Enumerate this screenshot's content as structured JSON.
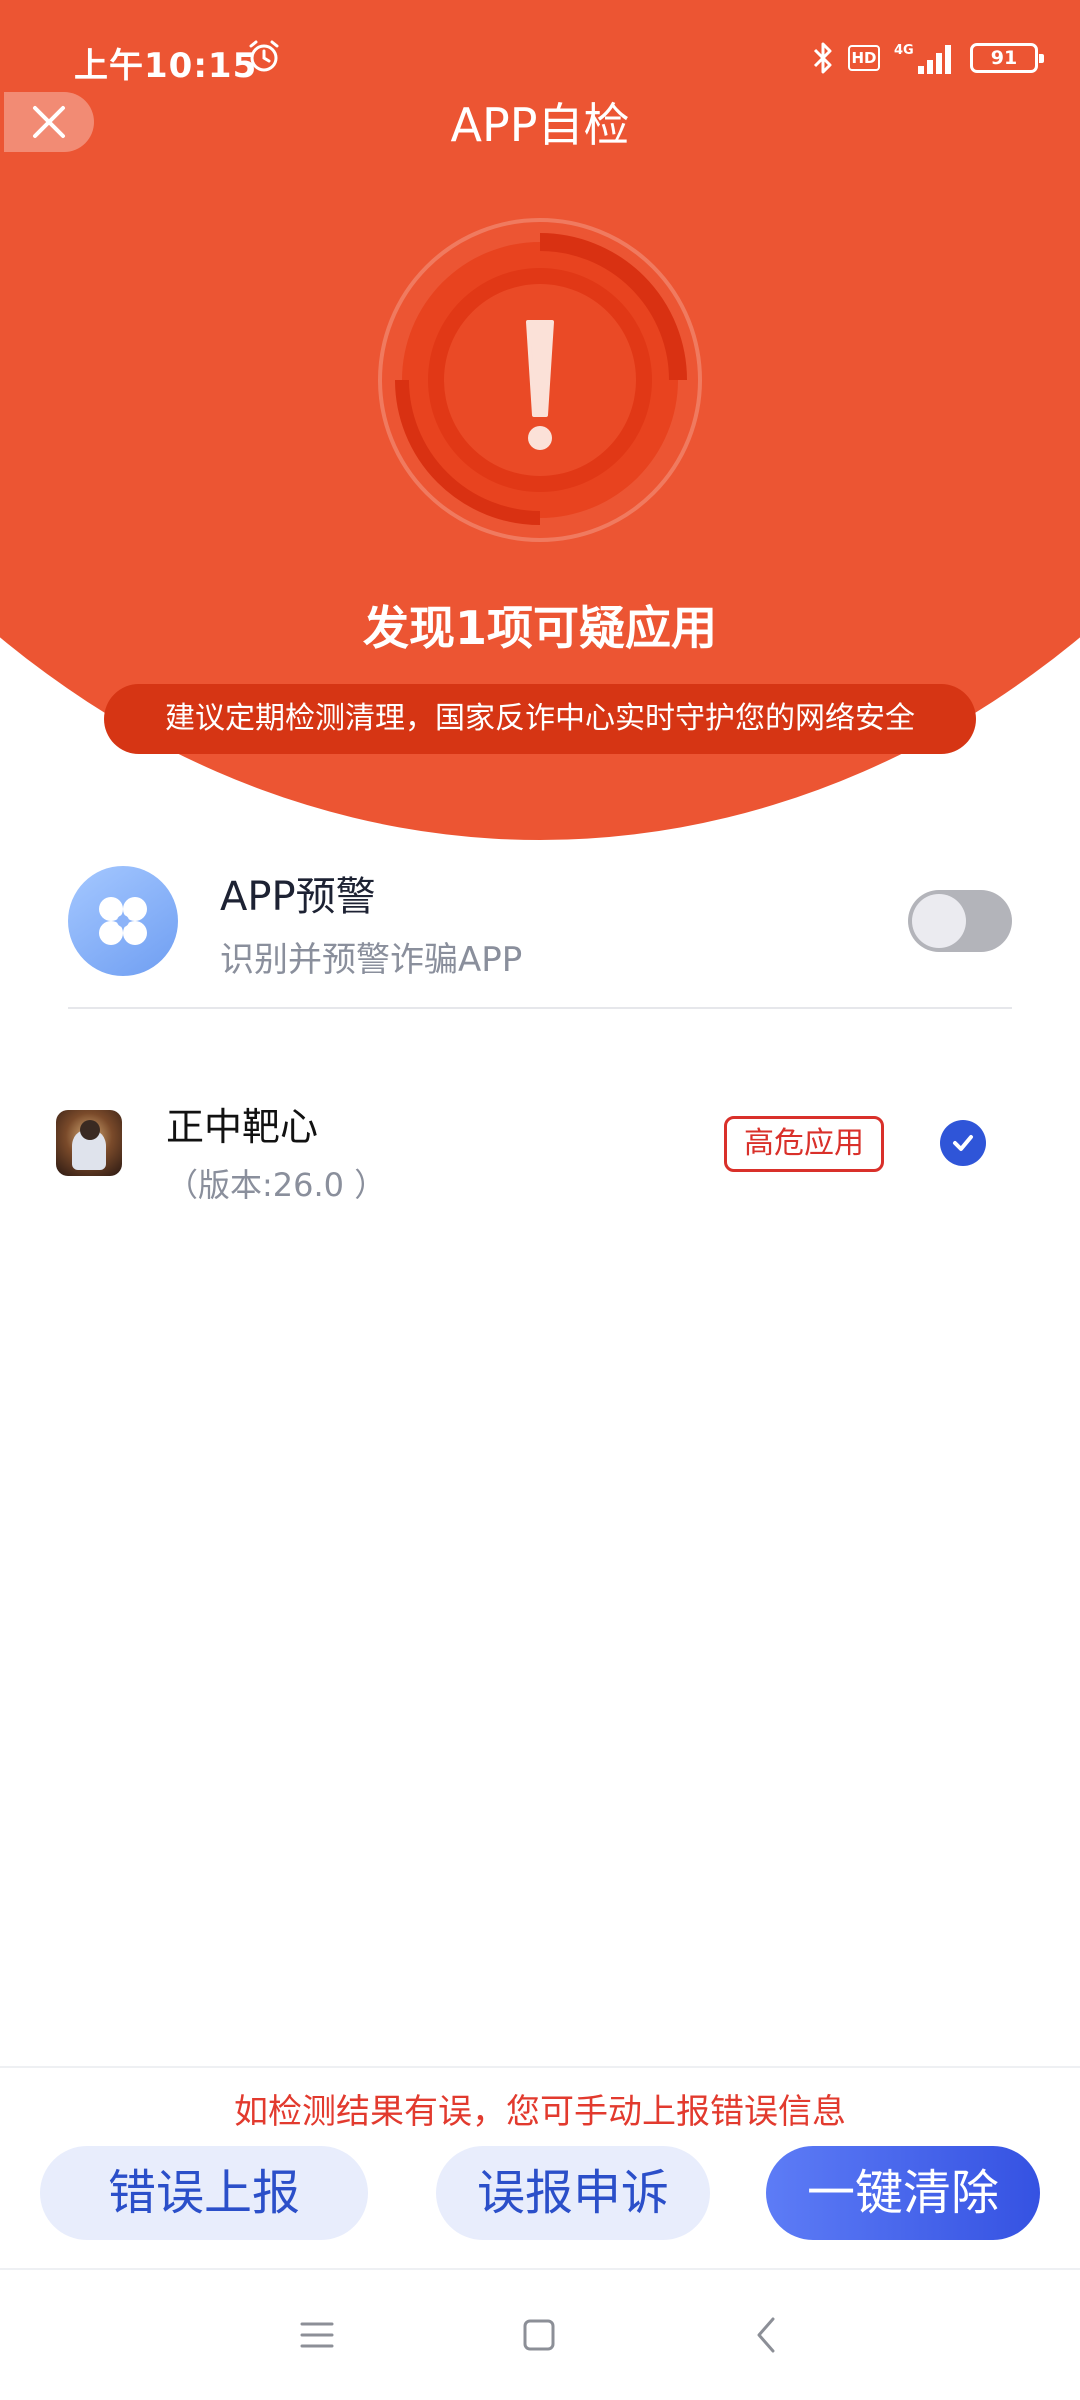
{
  "status_bar": {
    "time": "上午10:15",
    "hd_label": "HD",
    "network_label": "4G",
    "battery": "91"
  },
  "header": {
    "title": "APP自检"
  },
  "result": {
    "title": "发现1项可疑应用",
    "advice": "建议定期检测清理，国家反诈中心实时守护您的网络安全",
    "accent_color": "#ec5533"
  },
  "warning": {
    "title": "APP预警",
    "subtitle": "识别并预警诈骗APP",
    "toggle_on": false
  },
  "apps": [
    {
      "name": "正中靶心",
      "version": "（版本:26.0 ）",
      "badge": "高危应用",
      "selected": true
    }
  ],
  "footer": {
    "hint": "如检测结果有误，您可手动上报错误信息",
    "report_button": "错误上报",
    "appeal_button": "误报申诉",
    "clear_button": "一键清除"
  },
  "icons": {
    "close": "close-icon",
    "alarm": "alarm-icon",
    "bluetooth": "bluetooth-icon",
    "signal": "signal-icon",
    "warning_app": "app-grid-icon",
    "check": "check-icon"
  }
}
